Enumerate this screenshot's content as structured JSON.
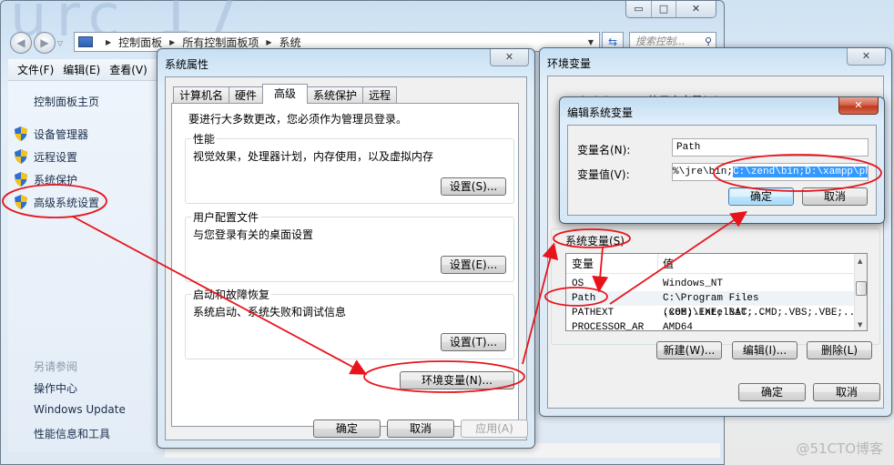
{
  "explorer": {
    "breadcrumb": [
      "控制面板",
      "所有控制面板项",
      "系统"
    ],
    "search_placeholder": "搜索控制...",
    "menu": [
      "文件(F)",
      "编辑(E)",
      "查看(V)"
    ],
    "left_pane": {
      "home": "控制面板主页",
      "tasks": [
        "设备管理器",
        "远程设置",
        "系统保护",
        "高级系统设置"
      ],
      "see_also_title": "另请参阅",
      "see_also": [
        "操作中心",
        "Windows Update",
        "性能信息和工具"
      ]
    },
    "caption_buttons": {
      "minimize": "▭",
      "maximize": "□",
      "close": "✕"
    }
  },
  "system_properties": {
    "title": "系统属性",
    "tabs": [
      "计算机名",
      "硬件",
      "高级",
      "系统保护",
      "远程"
    ],
    "active_tab": "高级",
    "admin_note": "要进行大多数更改，您必须作为管理员登录。",
    "groups": [
      {
        "legend": "性能",
        "description": "视觉效果，处理器计划，内存使用，以及虚拟内存",
        "button": "设置(S)..."
      },
      {
        "legend": "用户配置文件",
        "description": "与您登录有关的桌面设置",
        "button": "设置(E)..."
      },
      {
        "legend": "启动和故障恢复",
        "description": "系统启动、系统失败和调试信息",
        "button": "设置(T)..."
      }
    ],
    "env_button": "环境变量(N)...",
    "ok": "确定",
    "cancel": "取消",
    "apply": "应用(A)"
  },
  "environment_variables": {
    "title": "环境变量",
    "user_vars_label": "Administrator 的用户变量(U)",
    "system_vars_label": "系统变量(S)",
    "columns": [
      "变量",
      "值"
    ],
    "rows": [
      {
        "name": "OS",
        "value": "Windows_NT"
      },
      {
        "name": "Path",
        "value": "C:\\Program Files (x86)\\Intel\\iC..."
      },
      {
        "name": "PATHEXT",
        "value": ".COM;.EXE;.BAT;.CMD;.VBS;.VBE;...."
      },
      {
        "name": "PROCESSOR_AR",
        "value": "AMD64"
      }
    ],
    "new_button": "新建(W)...",
    "edit_button": "编辑(I)...",
    "delete_button": "删除(L)",
    "ok": "确定",
    "cancel": "取消"
  },
  "edit_system_variable": {
    "title": "编辑系统变量",
    "name_label": "变量名(N):",
    "name_value": "Path",
    "value_label": "变量值(V):",
    "value_prefix": "%\\jre\\bin;",
    "value_selected": "C:\\zend\\bin;D:\\xampp\\php;",
    "ok": "确定",
    "cancel": "取消"
  },
  "annotation_color": "#e8141c",
  "watermark": "@51CTO博客"
}
